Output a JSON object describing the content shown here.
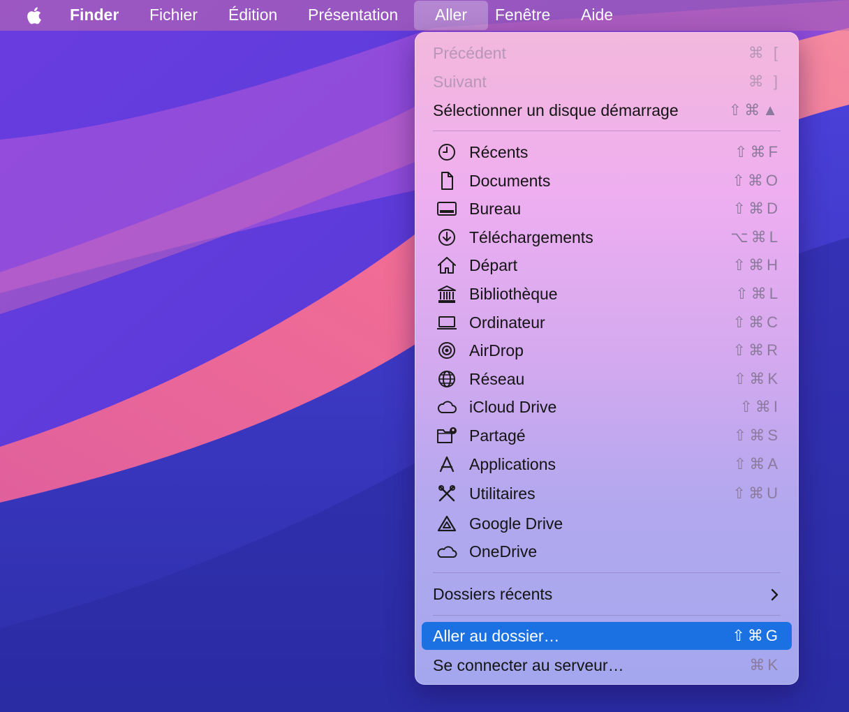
{
  "menubar": {
    "apple_icon": "apple-logo-icon",
    "items": [
      {
        "label": "Finder"
      },
      {
        "label": "Fichier"
      },
      {
        "label": "Édition"
      },
      {
        "label": "Présentation"
      },
      {
        "label": "Aller"
      },
      {
        "label": "Fenêtre"
      },
      {
        "label": "Aide"
      }
    ],
    "active_menu": "Aller"
  },
  "menu": {
    "history": [
      {
        "label": "Précédent",
        "shortcut": "⌘ [",
        "enabled": false
      },
      {
        "label": "Suivant",
        "shortcut": "⌘ ]",
        "enabled": false
      },
      {
        "label": "Sélectionner un disque démarrage",
        "shortcut": "⇧⌘▲",
        "enabled": true
      }
    ],
    "places": [
      {
        "label": "Récents",
        "shortcut": "⇧⌘F",
        "icon": "clock-icon"
      },
      {
        "label": "Documents",
        "shortcut": "⇧⌘O",
        "icon": "document-icon"
      },
      {
        "label": "Bureau",
        "shortcut": "⇧⌘D",
        "icon": "desktop-icon"
      },
      {
        "label": "Téléchargements",
        "shortcut": "⌥⌘L",
        "icon": "download-icon"
      },
      {
        "label": "Départ",
        "shortcut": "⇧⌘H",
        "icon": "home-icon"
      },
      {
        "label": "Bibliothèque",
        "shortcut": "⇧⌘L",
        "icon": "library-icon"
      },
      {
        "label": "Ordinateur",
        "shortcut": "⇧⌘C",
        "icon": "laptop-icon"
      },
      {
        "label": "AirDrop",
        "shortcut": "⇧⌘R",
        "icon": "airdrop-icon"
      },
      {
        "label": "Réseau",
        "shortcut": "⇧⌘K",
        "icon": "globe-icon"
      },
      {
        "label": "iCloud Drive",
        "shortcut": "⇧⌘I",
        "icon": "cloud-icon"
      },
      {
        "label": "Partagé",
        "shortcut": "⇧⌘S",
        "icon": "shared-folder-icon"
      },
      {
        "label": "Applications",
        "shortcut": "⇧⌘A",
        "icon": "applications-icon"
      },
      {
        "label": "Utilitaires",
        "shortcut": "⇧⌘U",
        "icon": "utilities-icon"
      },
      {
        "label": "Google Drive",
        "shortcut": "",
        "icon": "google-drive-icon"
      },
      {
        "label": "OneDrive",
        "shortcut": "",
        "icon": "onedrive-cloud-icon"
      }
    ],
    "recent_folders": {
      "label": "Dossiers récents",
      "icon": "chevron-right-icon"
    },
    "go_to_folder": {
      "label": "Aller au dossier…",
      "shortcut": "⇧⌘G",
      "selected": true
    },
    "connect_server": {
      "label": "Se connecter au serveur…",
      "shortcut": "⌘K"
    }
  },
  "colors": {
    "selection": "#1b71e2",
    "menu_text": "#141414",
    "disabled_text": "#b796b8",
    "shortcut_text": "#8c7a9c"
  }
}
